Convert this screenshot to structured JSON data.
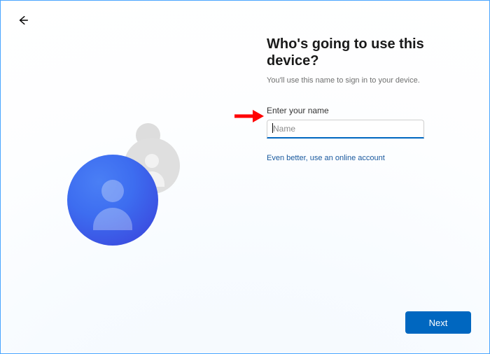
{
  "header": {
    "title": "Who's going to use this device?",
    "subtitle": "You'll use this name to sign in to your device."
  },
  "form": {
    "name_label": "Enter your name",
    "name_placeholder": "Name",
    "name_value": "",
    "online_account_link": "Even better, use an online account"
  },
  "actions": {
    "next_label": "Next"
  },
  "icons": {
    "back": "back-arrow-icon",
    "avatar_big": "user-avatar-large",
    "avatar_med": "user-avatar-medium",
    "avatar_small": "circle-small"
  },
  "colors": {
    "accent": "#0067c0",
    "link": "#19599e",
    "avatar_gradient_start": "#4a7ff5",
    "avatar_gradient_end": "#3a3fd9"
  }
}
